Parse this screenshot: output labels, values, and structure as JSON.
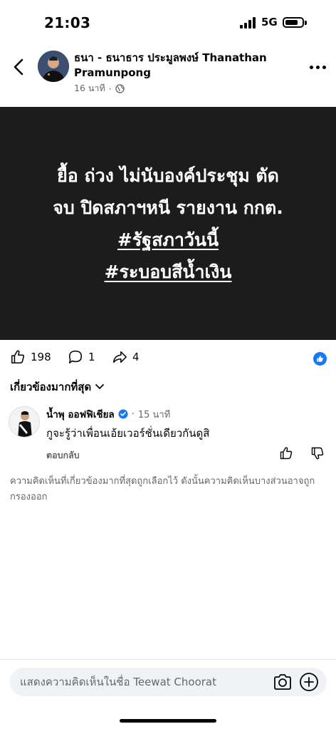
{
  "status_bar": {
    "time": "21:03",
    "network": "5G"
  },
  "post": {
    "author": "ธนา - ธนาธาร ประมูลพงษ์ Thanathan Pramunpong",
    "time": "16 นาที",
    "privacy_icon": "globe-icon",
    "lines": [
      "ยื้อ ถ่วง ไม่นับองค์ประชุม ตัด",
      "จบ ปิดสภาฯหนี รายงาน กกต."
    ],
    "hashtags": [
      "#รัฐสภาวันนี้",
      "#ระบอบสีน้ำเงิน"
    ]
  },
  "reactions": {
    "likes": "198",
    "comments": "1",
    "shares": "4"
  },
  "filter_label": "เกี่ยวข้องมากที่สุด",
  "comment": {
    "author": "น้ำพุ ออฟฟิเชียล",
    "time": "15 นาที",
    "text": "กูจะรู้ว่าเพื่อนเอ้ยเวอร์ชั่นเดียวกันดูสิ",
    "reply_label": "ตอบกลับ"
  },
  "notice": "ความคิดเห็นที่เกี่ยวข้องมากที่สุดถูกเลือกไว้ ดังนั้นความคิดเห็นบางส่วนอาจถูกกรองออก",
  "composer": {
    "placeholder": "แสดงความคิดเห็นในชื่อ Teewat Choorat"
  },
  "colors": {
    "accent": "#1877f2",
    "post_bg": "#1c1c1c",
    "muted": "#65676b"
  }
}
